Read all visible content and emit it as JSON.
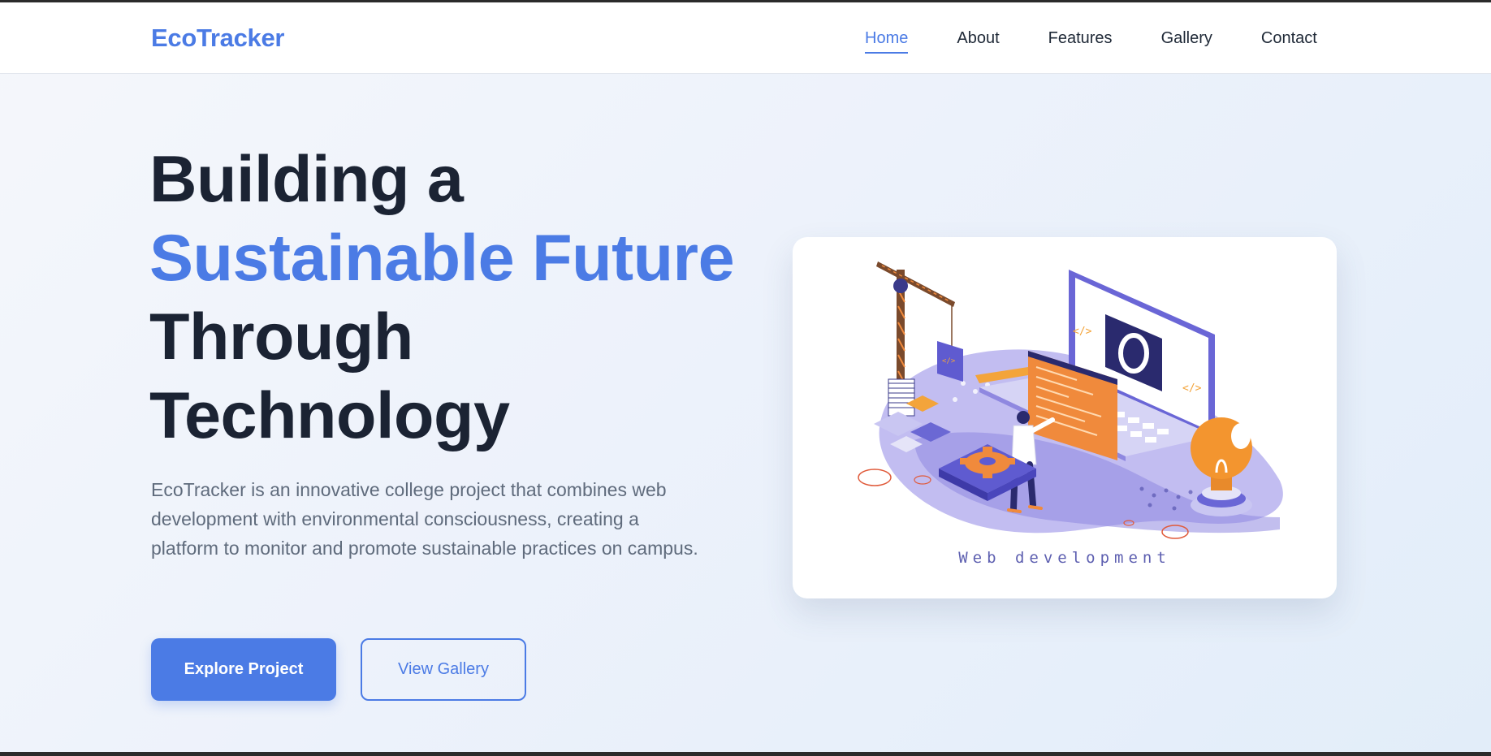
{
  "brand": {
    "name": "EcoTracker",
    "accent": "#4b7be5"
  },
  "nav": {
    "items": [
      {
        "label": "Home",
        "active": true
      },
      {
        "label": "About"
      },
      {
        "label": "Features"
      },
      {
        "label": "Gallery"
      },
      {
        "label": "Contact"
      }
    ]
  },
  "hero": {
    "title_part1": "Building a",
    "title_accent": "Sustainable Future",
    "title_part2": "Through Technology",
    "description": "EcoTracker is an innovative college project that combines web development with environmental consciousness, creating a platform to monitor and promote sustainable practices on campus.",
    "primary_button": "Explore Project",
    "secondary_button": "View Gallery"
  },
  "illustration": {
    "caption": "Web development",
    "icons": [
      "crane-icon",
      "laptop-icon",
      "lightbulb-icon",
      "gear-icon",
      "person-icon"
    ]
  }
}
